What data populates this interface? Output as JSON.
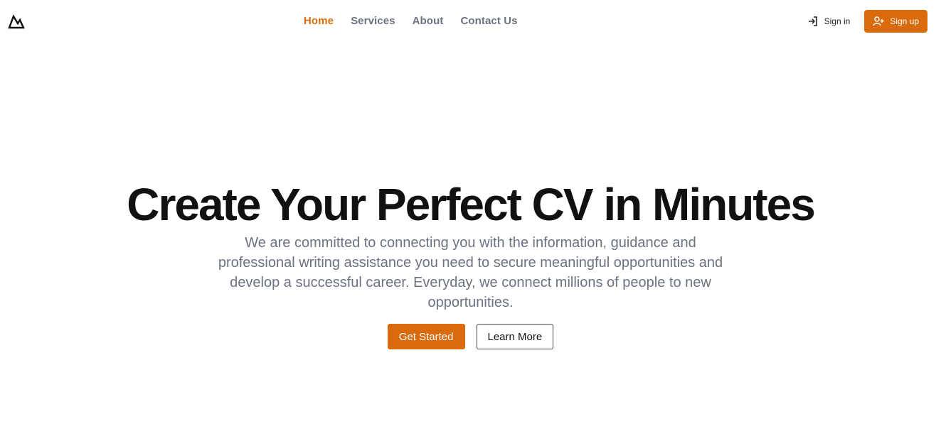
{
  "nav": {
    "logo_icon": "mountain-logo-icon",
    "links": [
      {
        "label": "Home",
        "active": true
      },
      {
        "label": "Services",
        "active": false
      },
      {
        "label": "About",
        "active": false
      },
      {
        "label": "Contact Us",
        "active": false
      }
    ],
    "signin_label": "Sign in",
    "signin_icon": "login-arrow-icon",
    "signup_label": "Sign up",
    "signup_icon": "user-plus-icon"
  },
  "hero": {
    "title": "Create Your Perfect CV in Minutes",
    "description": "We are committed to connecting you with the information, guidance and professional writing assistance you need to secure meaningful opportunities and develop a successful career. Everyday, we connect millions of people to new opportunities.",
    "primary_button": "Get Started",
    "secondary_button": "Learn More"
  },
  "colors": {
    "accent": "#d96b0c",
    "muted_text": "#6b7280",
    "heading": "#111111"
  }
}
